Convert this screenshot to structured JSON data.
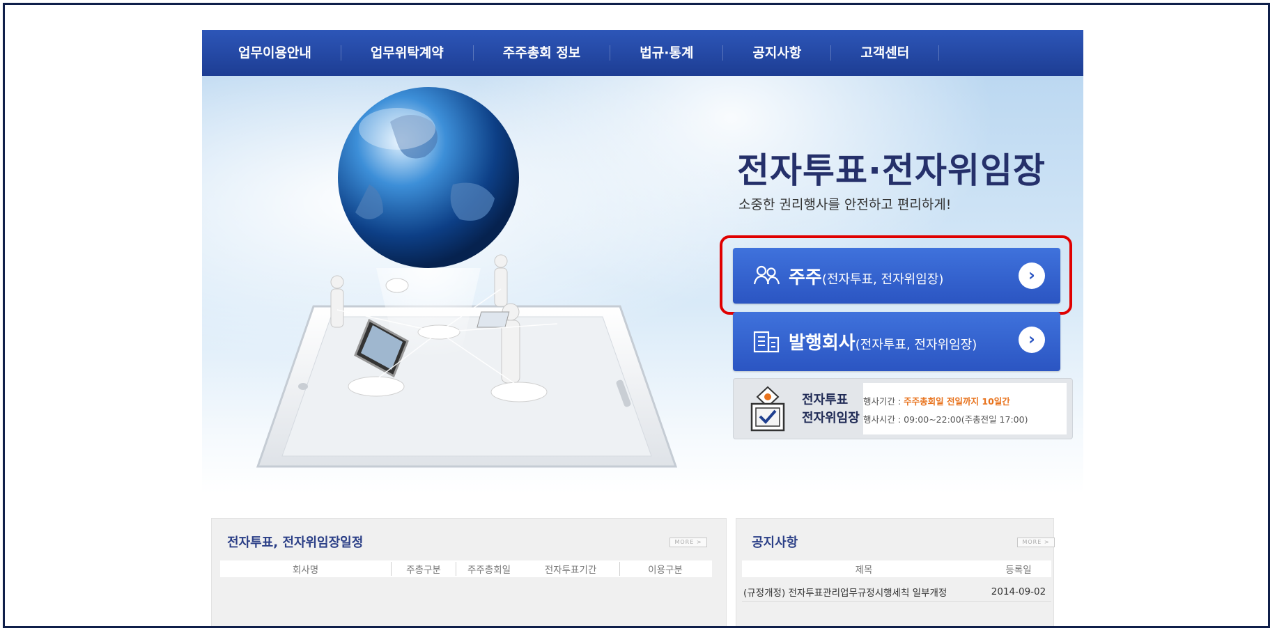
{
  "nav": {
    "items": [
      "업무이용안내",
      "업무위탁계약",
      "주주총회 정보",
      "법규·통계",
      "공지사항",
      "고객센터"
    ]
  },
  "hero": {
    "title": "전자투표·전자위임장",
    "subtitle": "소중한 권리행사를 안전하고 편리하게!"
  },
  "buttons": {
    "shareholder_main": "주주",
    "shareholder_sub": "(전자투표, 전자위임장)",
    "issuer_main": "발행회사",
    "issuer_sub": "(전자투표, 전자위임장)",
    "arrow": "›"
  },
  "info_box": {
    "label1": "전자투표",
    "label2": "전자위임장",
    "period_label": "행사기간 : ",
    "period_value": "주주총회일 전일까지 10일간",
    "time_label": "행사시간 : ",
    "time_value": "09:00~22:00(주총전일 17:00)"
  },
  "schedule_panel": {
    "title": "전자투표, 전자위임장일정",
    "more": "MORE >",
    "columns": [
      "회사명",
      "주총구분",
      "주주총회일",
      "전자투표기간",
      "이용구분"
    ]
  },
  "notice_panel": {
    "title": "공지사항",
    "more": "MORE >",
    "columns": [
      "제목",
      "등록일"
    ],
    "rows": [
      {
        "title": "(규정개정) 전자투표관리업무규정시행세칙 일부개정",
        "date": "2014-09-02"
      }
    ]
  },
  "colors": {
    "nav_blue": "#1d3d93",
    "button_blue": "#2b55c2",
    "highlight_red": "#e00000",
    "accent_orange": "#e8721c",
    "frame_navy": "#0f1f4a"
  }
}
